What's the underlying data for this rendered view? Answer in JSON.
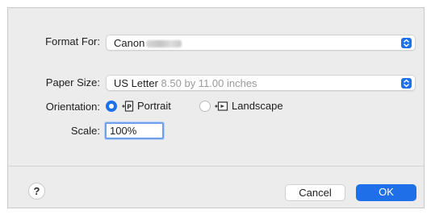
{
  "format_for": {
    "label": "Format For:",
    "value": "Canon"
  },
  "paper_size": {
    "label": "Paper Size:",
    "value": "US Letter",
    "detail": "8.50 by 11.00 inches"
  },
  "orientation": {
    "label": "Orientation:",
    "options": [
      {
        "label": "Portrait",
        "icon": "portrait-orientation-icon",
        "selected": true
      },
      {
        "label": "Landscape",
        "icon": "landscape-orientation-icon",
        "selected": false
      }
    ]
  },
  "scale": {
    "label": "Scale:",
    "value": "100%"
  },
  "buttons": {
    "help": "?",
    "cancel": "Cancel",
    "ok": "OK"
  },
  "colors": {
    "accent": "#1e6fe8",
    "dialog_background": "#ececec"
  }
}
